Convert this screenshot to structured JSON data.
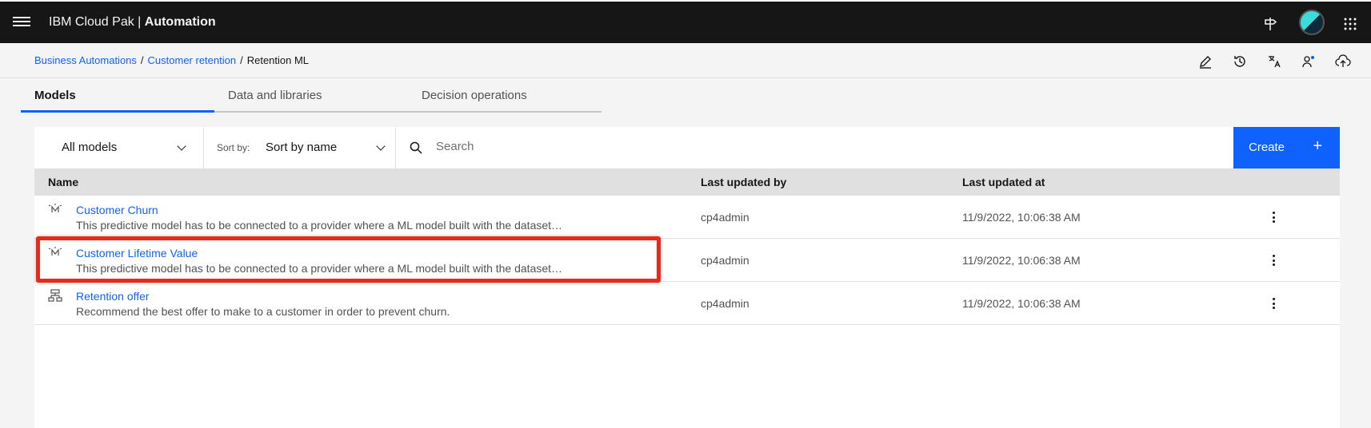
{
  "header": {
    "brand_prefix": "IBM Cloud Pak |",
    "brand_product": "Automation",
    "icons": [
      "menu-icon",
      "signpost-icon",
      "avatar",
      "app-switcher-icon"
    ]
  },
  "breadcrumb": {
    "items": [
      "Business Automations",
      "Customer retention"
    ],
    "separator": "/",
    "current": "Retention ML"
  },
  "actions": [
    "edit-icon",
    "history-icon",
    "translate-icon",
    "user-access-icon",
    "deploy-icon"
  ],
  "tabs": [
    {
      "label": "Models",
      "active": true
    },
    {
      "label": "Data and libraries",
      "active": false
    },
    {
      "label": "Decision operations",
      "active": false
    }
  ],
  "toolbar": {
    "filter_value": "All models",
    "sort_label": "Sort by:",
    "sort_value": "Sort by name",
    "search_placeholder": "Search",
    "create_label": "Create",
    "create_plus": "+"
  },
  "table": {
    "columns": [
      "Name",
      "Last updated by",
      "Last updated at"
    ],
    "rows": [
      {
        "icon": "ml-model-icon",
        "name": "Customer Churn",
        "description": "This predictive model has to be connected to a provider where a ML model built with the dataset…",
        "updated_by": "cp4admin",
        "updated_at": "11/9/2022, 10:06:38 AM"
      },
      {
        "icon": "ml-model-icon",
        "name": "Customer Lifetime Value",
        "description": "This predictive model has to be connected to a provider where a ML model built with the dataset…",
        "updated_by": "cp4admin",
        "updated_at": "11/9/2022, 10:06:38 AM"
      },
      {
        "icon": "decision-model-icon",
        "name": "Retention offer",
        "description": "Recommend the best offer to make to a customer in order to prevent churn.",
        "updated_by": "cp4admin",
        "updated_at": "11/9/2022, 10:06:38 AM"
      }
    ]
  },
  "colors": {
    "accent": "#0f62fe",
    "header_bg": "#161616",
    "highlight": "#e8291c"
  }
}
